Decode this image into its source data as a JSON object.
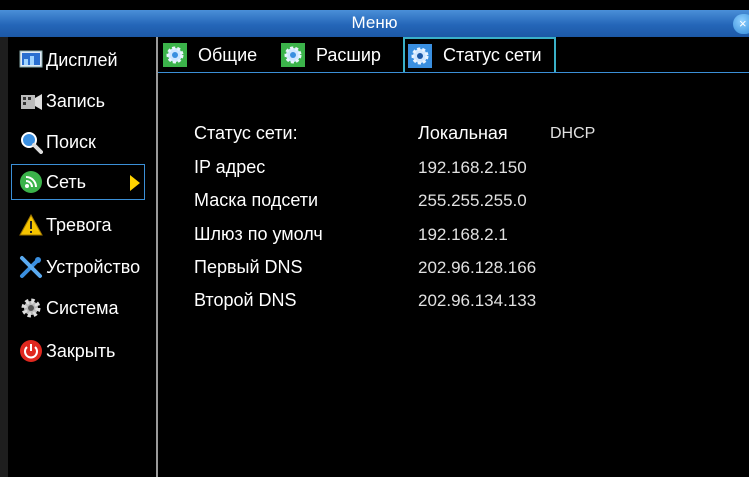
{
  "window": {
    "title": "Меню",
    "close_glyph": "×"
  },
  "sidebar": {
    "items": [
      {
        "label": "Дисплей",
        "icon": "display-icon"
      },
      {
        "label": "Запись",
        "icon": "record-icon"
      },
      {
        "label": "Поиск",
        "icon": "search-icon"
      },
      {
        "label": "Сеть",
        "icon": "network-icon",
        "selected": true
      },
      {
        "label": "Тревога",
        "icon": "alarm-icon"
      },
      {
        "label": "Устройство",
        "icon": "device-tools-icon"
      },
      {
        "label": "Система",
        "icon": "gear-icon"
      },
      {
        "label": "Закрыть",
        "icon": "power-icon"
      }
    ]
  },
  "tabs": [
    {
      "label": "Общие",
      "icon": "settings-tab-icon"
    },
    {
      "label": "Расшир",
      "icon": "settings-tab-icon"
    },
    {
      "label": "Статус сети",
      "icon": "settings-tab-icon",
      "active": true
    }
  ],
  "status": {
    "network_status_label": "Статус сети:",
    "network_status_value": "Локальная",
    "network_mode": "DHCP",
    "ip_label": "IP адрес",
    "ip_value": "192.168.2.150",
    "mask_label": "Маска подсети",
    "mask_value": "255.255.255.0",
    "gateway_label": "Шлюз по умолч",
    "gateway_value": "192.168.2.1",
    "dns1_label": "Первый DNS",
    "dns1_value": "202.96.128.166",
    "dns2_label": "Второй DNS",
    "dns2_value": "202.96.134.133"
  },
  "colors": {
    "accent": "#3b8fd6",
    "tab_active_border": "#3ab0c8",
    "arrow": "#ffd400"
  }
}
